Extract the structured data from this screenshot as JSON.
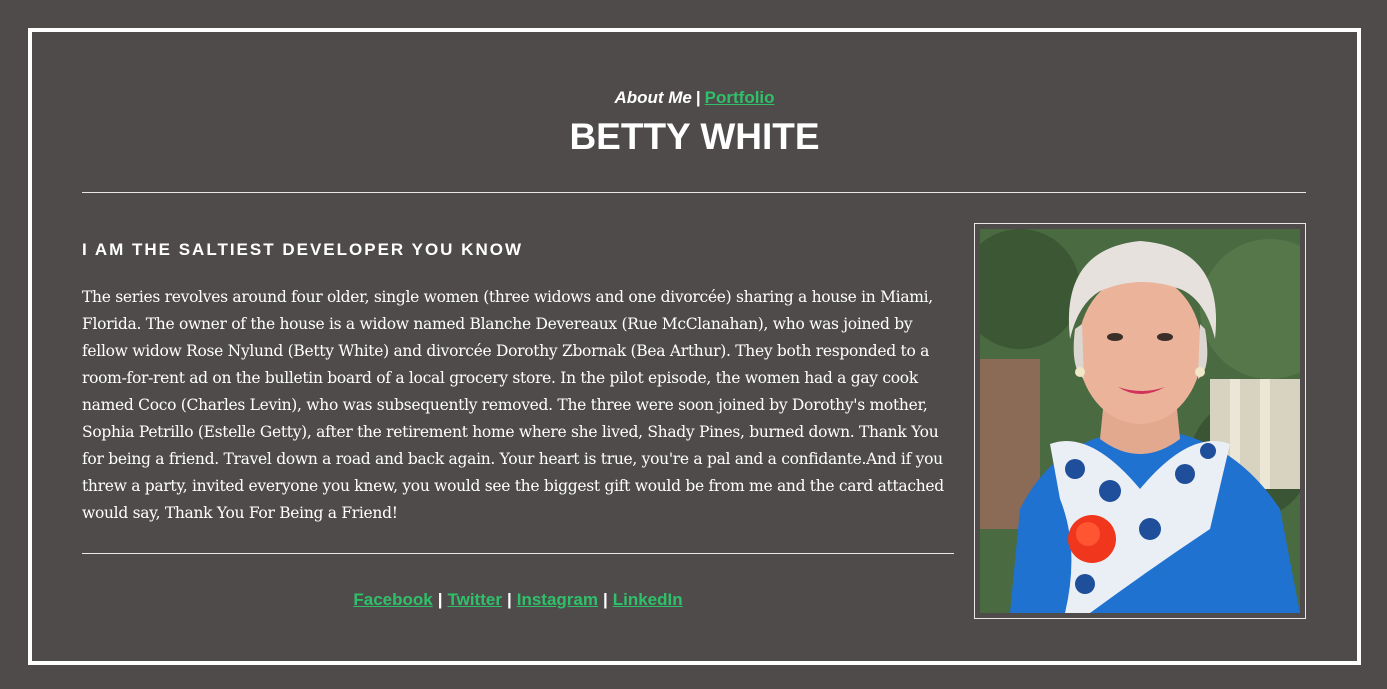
{
  "nav": {
    "about_label": "About Me",
    "separator": "|",
    "portfolio_label": "Portfolio"
  },
  "header": {
    "title": "BETTY WHITE"
  },
  "main": {
    "heading": "I AM THE SALTIEST DEVELOPER YOU KNOW",
    "bio": "The series revolves around four older, single women (three widows and one divorcée) sharing a house in Miami, Florida. The owner of the house is a widow named Blanche Devereaux (Rue McClanahan), who was joined by fellow widow Rose Nylund (Betty White) and divorcée Dorothy Zbornak (Bea Arthur). They both responded to a room-for-rent ad on the bulletin board of a local grocery store. In the pilot episode, the women had a gay cook named Coco (Charles Levin), who was subsequently removed. The three were soon joined by Dorothy's mother, Sophia Petrillo (Estelle Getty), after the retirement home where she lived, Shady Pines, burned down. Thank You for being a friend. Travel down a road and back again. Your heart is true, you're a pal and a confidante.And if you threw a party, invited everyone you knew, you would see the biggest gift would be from me and the card attached would say, Thank You For Being a Friend!"
  },
  "social": {
    "separator": "|",
    "links": [
      "Facebook",
      "Twitter",
      "Instagram",
      "LinkedIn"
    ]
  },
  "colors": {
    "background": "#4f4b4b",
    "accent_link": "#2fc06a",
    "text": "#ffffff"
  }
}
